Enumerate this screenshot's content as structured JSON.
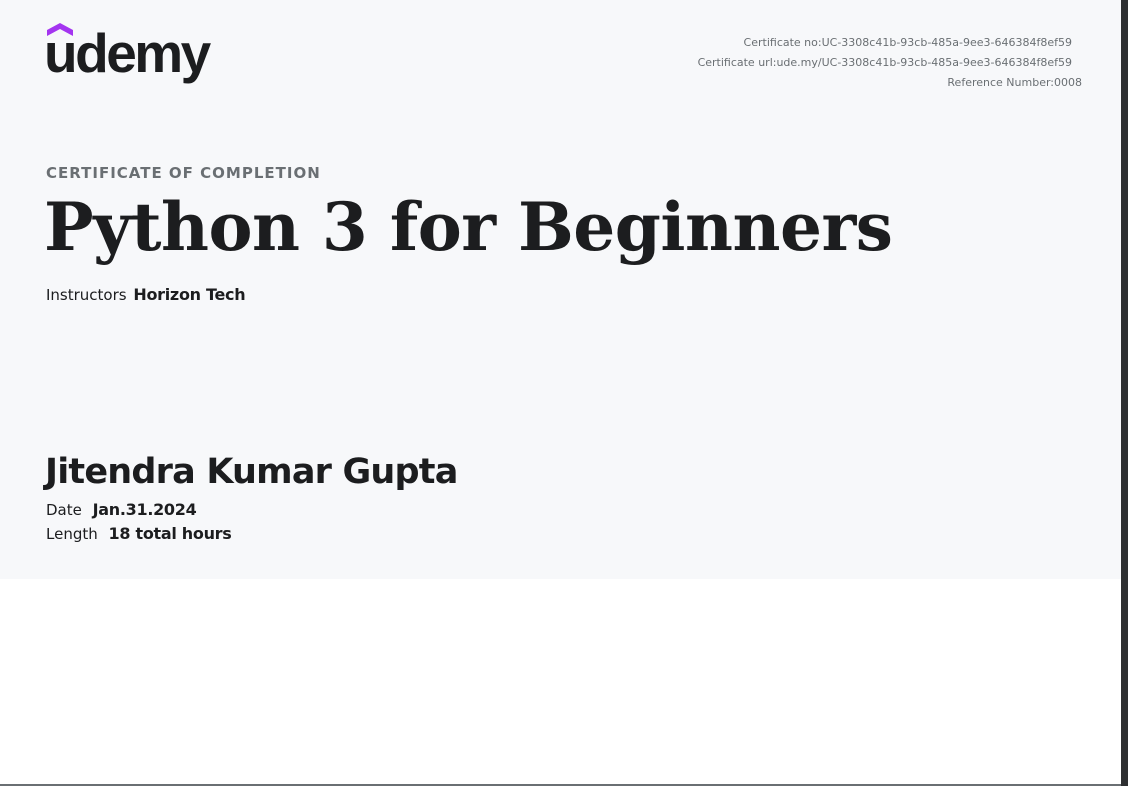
{
  "brand": {
    "logo_text": "udemy",
    "accent_color": "#a435f0"
  },
  "meta": {
    "certificate_no_label": "Certificate no:",
    "certificate_no": "UC-3308c41b-93cb-485a-9ee3-646384f8ef59",
    "certificate_url_label": "Certificate url:",
    "certificate_url": "ude.my/UC-3308c41b-93cb-485a-9ee3-646384f8ef59",
    "reference_label": "Reference Number:",
    "reference_number": "0008"
  },
  "certificate": {
    "kicker": "CERTIFICATE OF COMPLETION",
    "course_title": "Python 3 for Beginners",
    "instructors_label": "Instructors",
    "instructors": "Horizon Tech",
    "recipient": "Jitendra Kumar Gupta",
    "date_label": "Date",
    "date": "Jan.31.2024",
    "length_label": "Length",
    "length": "18 total hours"
  }
}
